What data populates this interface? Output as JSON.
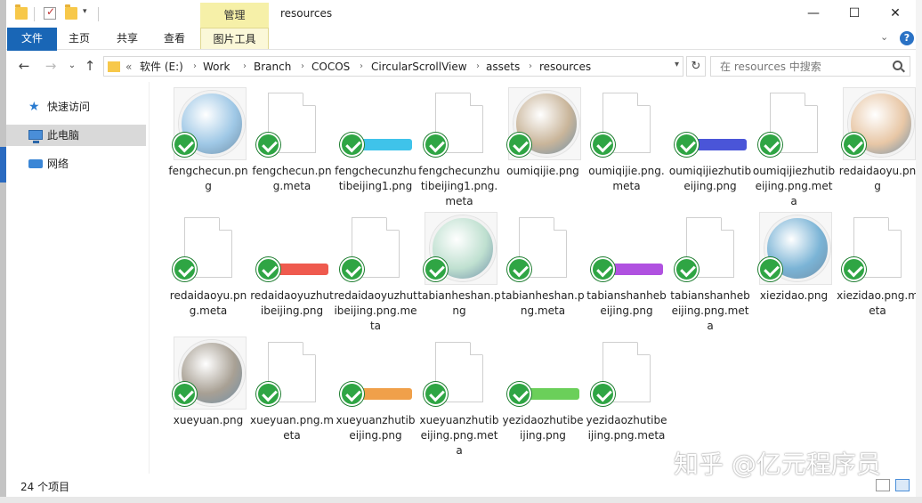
{
  "window": {
    "title": "resources",
    "manage_tab": "管理",
    "minimize": "—",
    "maximize": "☐",
    "close": "✕"
  },
  "ribbon": {
    "tabs": [
      "文件",
      "主页",
      "共享",
      "查看",
      "图片工具"
    ],
    "collapse_glyph": "⌄"
  },
  "nav": {
    "back": "←",
    "forward": "→",
    "recent": "⌄",
    "up": "↑",
    "path_prefix": "«",
    "crumbs": [
      "软件 (E:)",
      "Work",
      "Branch",
      "COCOS",
      "CircularScrollView",
      "assets",
      "resources"
    ],
    "crumb_sep": "›",
    "refresh": "↻",
    "search_placeholder": "在 resources 中搜索"
  },
  "sidebar": {
    "items": [
      {
        "label": "快速访问",
        "icon": "star-icon"
      },
      {
        "label": "此电脑",
        "icon": "computer-icon"
      },
      {
        "label": "网络",
        "icon": "network-icon"
      }
    ]
  },
  "files": [
    {
      "name": "fengchecun.png",
      "kind": "photo",
      "color": "#9fc8e6"
    },
    {
      "name": "fengchecun.png.meta",
      "kind": "doc"
    },
    {
      "name": "fengchecunzhutibeijing1.png",
      "kind": "bar",
      "color": "#3fc3ea"
    },
    {
      "name": "fengchecunzhutibeijing1.png.meta",
      "kind": "doc"
    },
    {
      "name": "oumiqijie.png",
      "kind": "photo",
      "color": "#c9b59a"
    },
    {
      "name": "oumiqijie.png.meta",
      "kind": "doc"
    },
    {
      "name": "oumiqijiezhutibeijing.png",
      "kind": "bar",
      "color": "#4a55d8"
    },
    {
      "name": "oumiqijiezhutibeijing.png.meta",
      "kind": "doc"
    },
    {
      "name": "redaidaoyu.png",
      "kind": "photo",
      "color": "#e8c7a6"
    },
    {
      "name": "redaidaoyu.png.meta",
      "kind": "doc"
    },
    {
      "name": "redaidaoyuzhutibeijing.png",
      "kind": "bar",
      "color": "#ef5a4e"
    },
    {
      "name": "redaidaoyuzhutibeijing.png.meta",
      "kind": "doc"
    },
    {
      "name": "tabianheshan.png",
      "kind": "photo",
      "color": "#bfe0d0"
    },
    {
      "name": "tabianheshan.png.meta",
      "kind": "doc"
    },
    {
      "name": "tabianshanhebeijing.png",
      "kind": "bar",
      "color": "#b051e0"
    },
    {
      "name": "tabianshanhebeijing.png.meta",
      "kind": "doc"
    },
    {
      "name": "xiezidao.png",
      "kind": "photo",
      "color": "#7bb4d6"
    },
    {
      "name": "xiezidao.png.meta",
      "kind": "doc"
    },
    {
      "name": "xueyuan.png",
      "kind": "photo",
      "color": "#a8a094"
    },
    {
      "name": "xueyuan.png.meta",
      "kind": "doc"
    },
    {
      "name": "xueyuanzhutibeijing.png",
      "kind": "bar",
      "color": "#f0a04a"
    },
    {
      "name": "xueyuanzhutibeijing.png.meta",
      "kind": "doc"
    },
    {
      "name": "yezidaozhutibeijing.png",
      "kind": "bar",
      "color": "#6bcf5a"
    },
    {
      "name": "yezidaozhutibeijing.png.meta",
      "kind": "doc"
    }
  ],
  "status": {
    "count": "24 个项目"
  },
  "watermark": "知乎 @亿元程序员"
}
